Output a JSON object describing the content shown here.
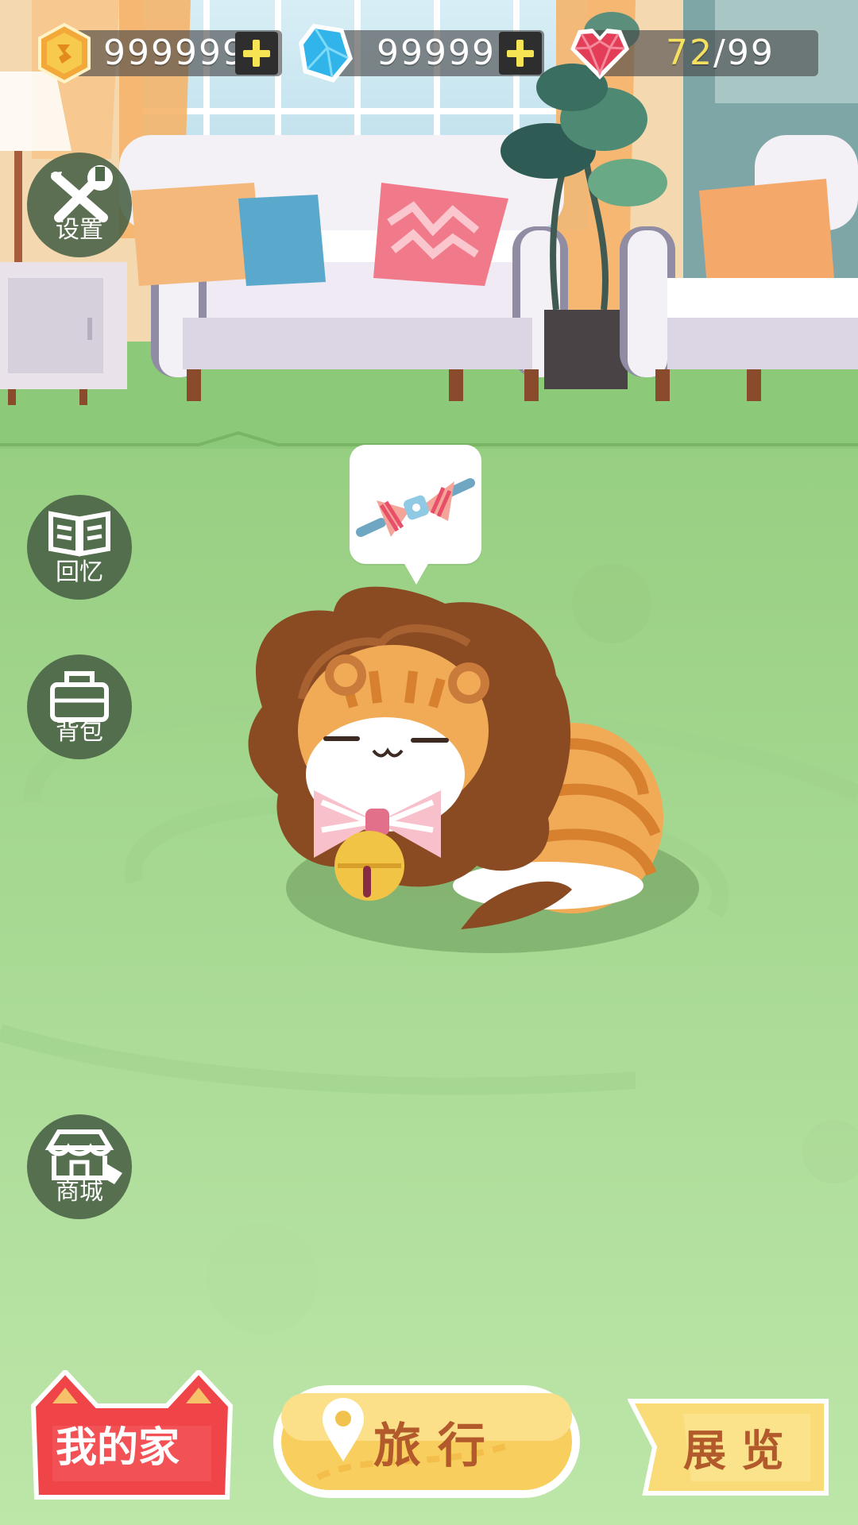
{
  "resources": {
    "coins": {
      "value": "999999",
      "icon": "gold-coin-icon",
      "add_icon": "plus-icon"
    },
    "gems": {
      "value": "99999",
      "icon": "blue-gem-icon",
      "add_icon": "plus-icon"
    },
    "hearts": {
      "current": "72",
      "separator": "/",
      "max": "99",
      "icon": "red-heart-gem-icon"
    }
  },
  "side_menu": [
    {
      "id": "settings",
      "label": "设置",
      "icon": "wrench-screwdriver-icon"
    },
    {
      "id": "memories",
      "label": "回忆",
      "icon": "open-book-icon"
    },
    {
      "id": "backpack",
      "label": "背包",
      "icon": "bag-icon"
    },
    {
      "id": "shop",
      "label": "商城",
      "icon": "storefront-icon"
    }
  ],
  "pet": {
    "thought_item": "bow-tie-icon"
  },
  "bottom_nav": {
    "home": {
      "label": "我的家",
      "icon": "cat-ears-tab"
    },
    "travel": {
      "label": "旅 行",
      "icon": "map-pin-icon"
    },
    "exhibit": {
      "label": "展 览"
    }
  },
  "colors": {
    "floor": "#a7d98f",
    "wall_floor": "#93c97e",
    "home_tab": "#f0474a",
    "travel_button": "#f8d46a",
    "exhibit_tab": "#f9df7a",
    "heart_current": "#f6e060"
  }
}
